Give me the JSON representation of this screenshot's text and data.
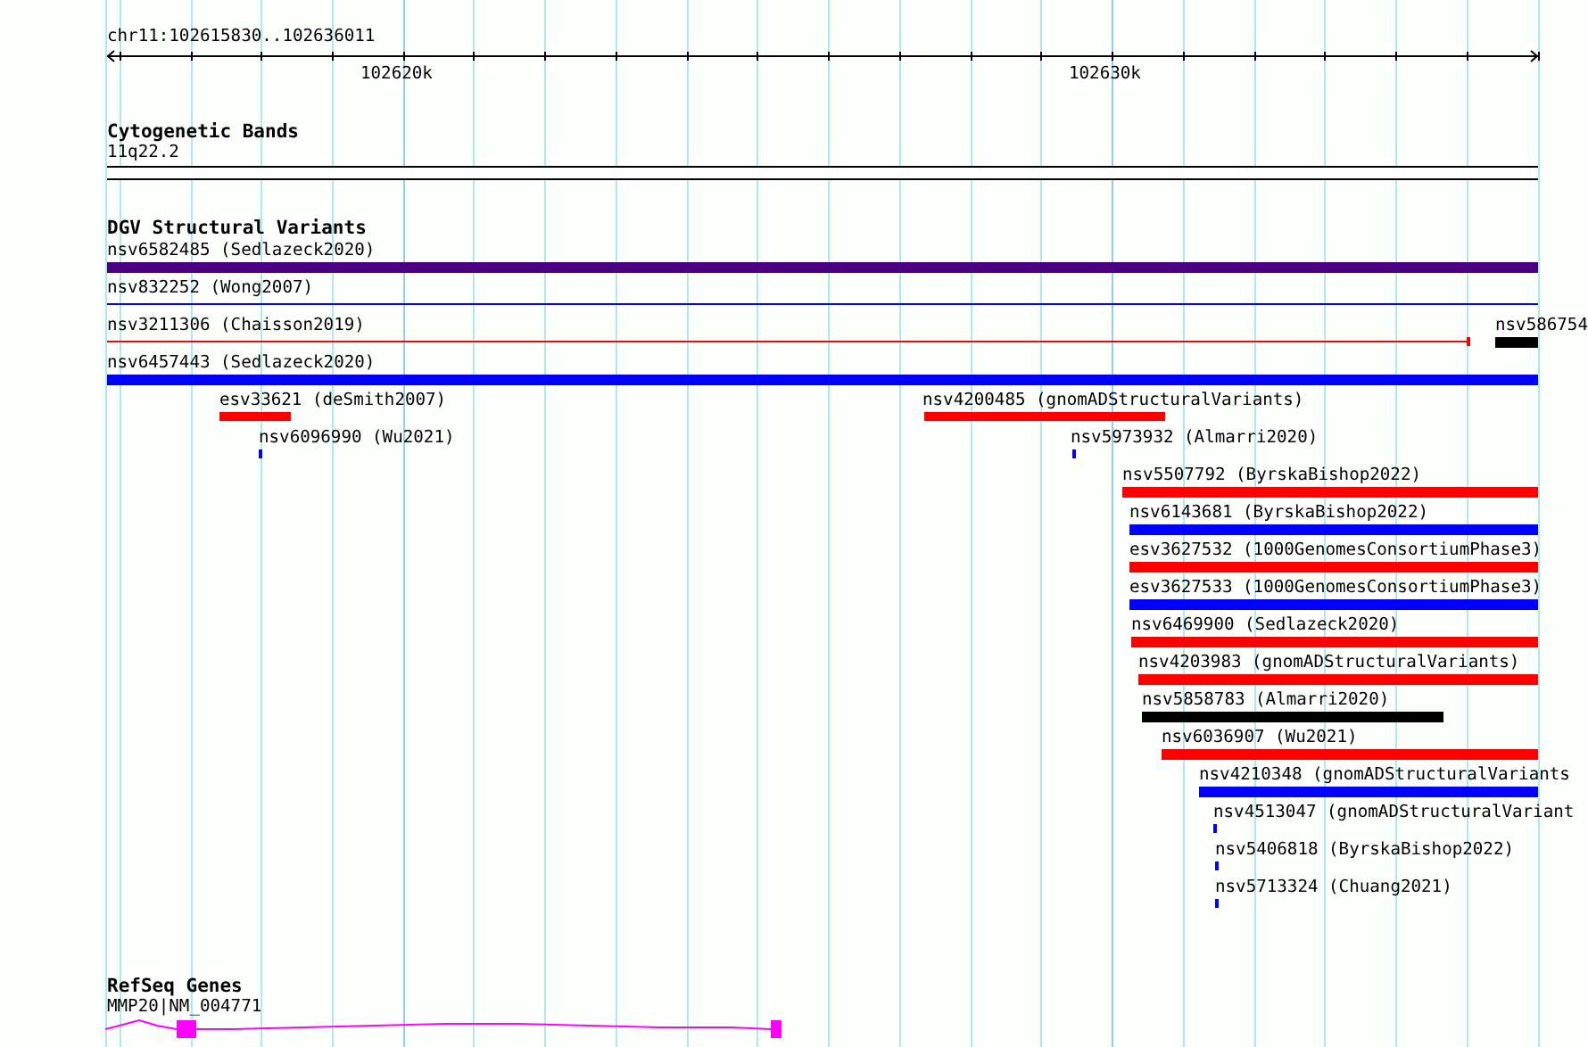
{
  "ruler": {
    "location": "chr11:102615830..102636011",
    "ticks": [
      {
        "label": "102620k"
      },
      {
        "label": "102630k"
      }
    ]
  },
  "tracks": [
    {
      "kind": "cytoband",
      "title": "Cytogenetic Bands",
      "features": [
        {
          "label": "11q22.2"
        }
      ]
    },
    {
      "kind": "variants",
      "title": "DGV Structural Variants",
      "features": [
        {
          "label": "nsv6582485 (Sedlazeck2020)",
          "kind": "bar",
          "color": "#4b0082"
        },
        {
          "label": "nsv832252 (Wong2007)",
          "kind": "line",
          "color": "#0000ff"
        },
        {
          "label": "nsv3211306 (Chaisson2019)",
          "kind": "capped-line",
          "color": "#ff0000"
        },
        {
          "label": "nsv586754",
          "kind": "bar",
          "color": "#000000"
        },
        {
          "label": "nsv6457443 (Sedlazeck2020)",
          "kind": "bar",
          "color": "#0000ff"
        },
        {
          "label": "esv33621 (deSmith2007)",
          "kind": "bar",
          "color": "#ff0000"
        },
        {
          "label": "nsv4200485 (gnomADStructuralVariants)",
          "kind": "bar",
          "color": "#ff0000"
        },
        {
          "label": "nsv6096990 (Wu2021)",
          "kind": "bar",
          "color": "#0000ff"
        },
        {
          "label": "nsv5973932 (Almarri2020)",
          "kind": "bar",
          "color": "#0000ff"
        },
        {
          "label": "nsv5507792 (ByrskaBishop2022)",
          "kind": "bar",
          "color": "#ff0000"
        },
        {
          "label": "nsv6143681 (ByrskaBishop2022)",
          "kind": "bar",
          "color": "#0000ff"
        },
        {
          "label": "esv3627532 (1000GenomesConsortiumPhase3)",
          "kind": "bar",
          "color": "#ff0000"
        },
        {
          "label": "esv3627533 (1000GenomesConsortiumPhase3)",
          "kind": "bar",
          "color": "#0000ff"
        },
        {
          "label": "nsv6469900 (Sedlazeck2020)",
          "kind": "bar",
          "color": "#ff0000"
        },
        {
          "label": "nsv4203983 (gnomADStructuralVariants)",
          "kind": "bar",
          "color": "#ff0000"
        },
        {
          "label": "nsv5858783 (Almarri2020)",
          "kind": "bar",
          "color": "#000000"
        },
        {
          "label": "nsv6036907 (Wu2021)",
          "kind": "bar",
          "color": "#ff0000"
        },
        {
          "label": "nsv4210348 (gnomADStructuralVariants",
          "kind": "bar",
          "color": "#0000ff"
        },
        {
          "label": "nsv4513047 (gnomADStructuralVariant",
          "kind": "bar",
          "color": "#0000ff"
        },
        {
          "label": "nsv5406818 (ByrskaBishop2022)",
          "kind": "bar",
          "color": "#0000ff"
        },
        {
          "label": "nsv5713324 (Chuang2021)",
          "kind": "bar",
          "color": "#0000ff"
        }
      ]
    },
    {
      "kind": "genes",
      "title": "RefSeq Genes",
      "features": [
        {
          "label": "MMP20|NM_004771",
          "color": "#ff00ff"
        }
      ]
    }
  ]
}
